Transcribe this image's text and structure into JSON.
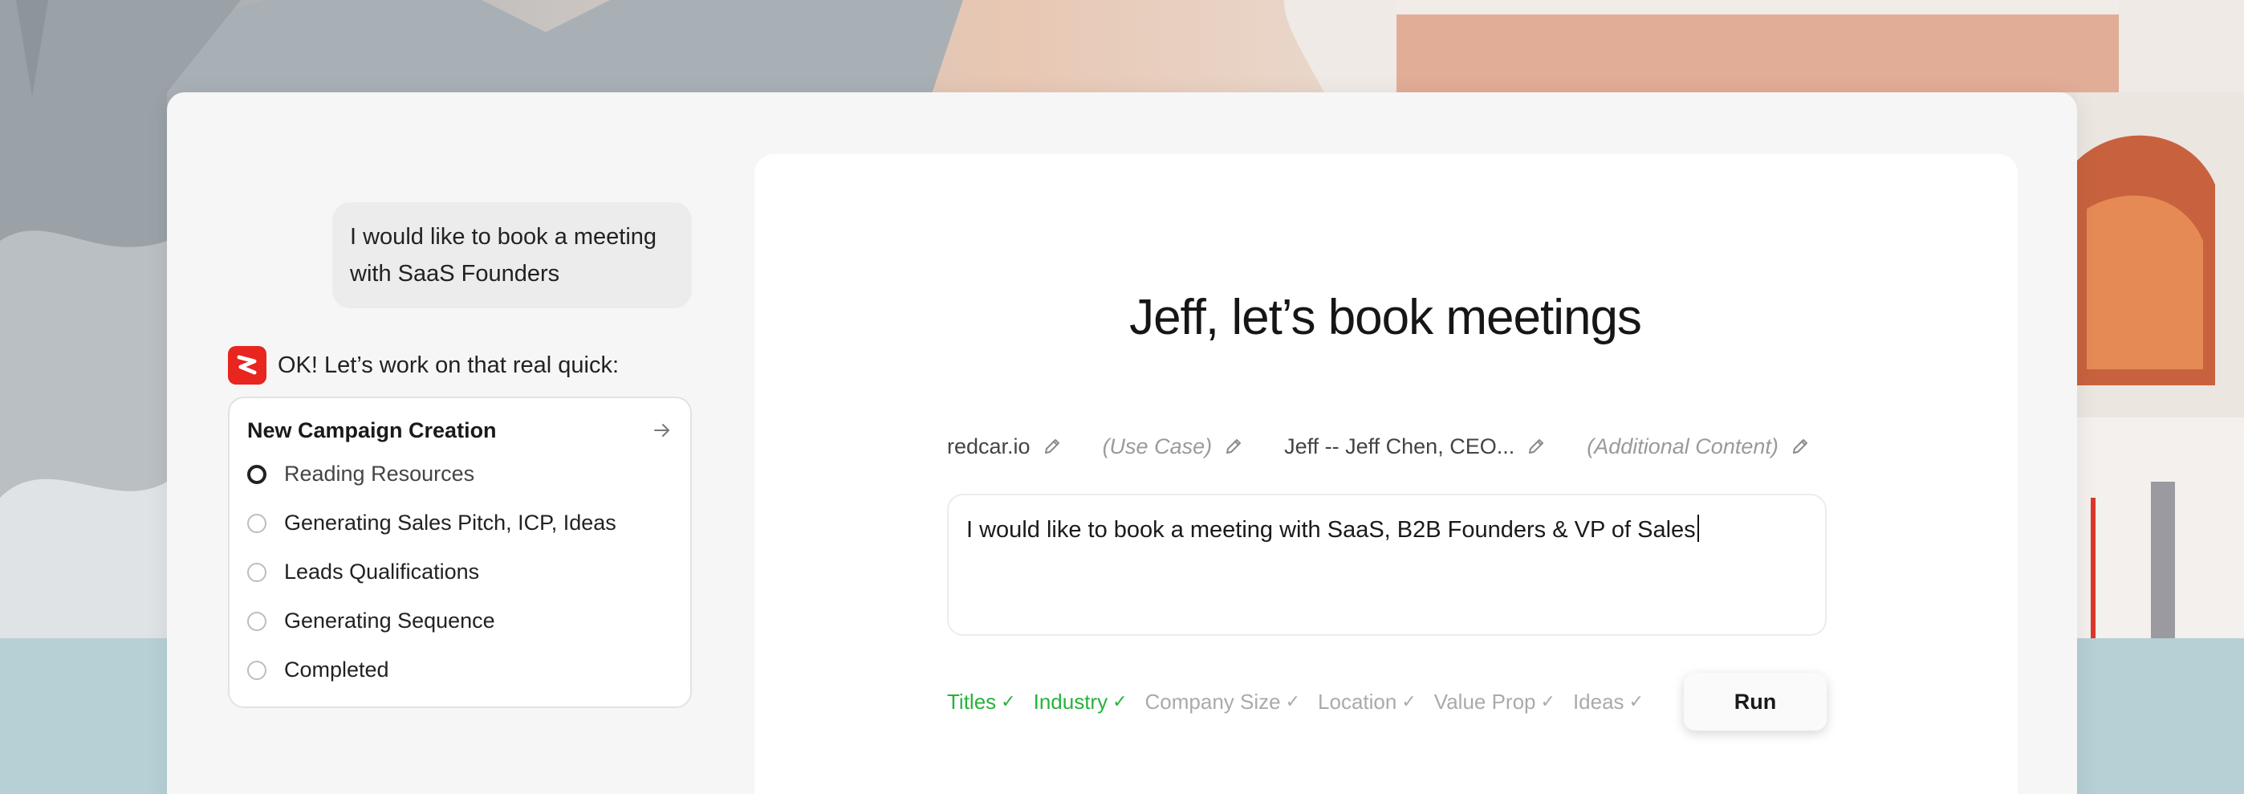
{
  "chat": {
    "user_message": "I would like to book a meeting with SaaS Founders",
    "bot_reply": "OK! Let’s work on that real quick:"
  },
  "task": {
    "title": "New Campaign Creation",
    "steps": [
      {
        "label": "Reading Resources",
        "state": "active"
      },
      {
        "label": "Generating Sales Pitch, ICP, Ideas",
        "state": "pending"
      },
      {
        "label": "Leads Qualifications",
        "state": "pending"
      },
      {
        "label": "Generating Sequence",
        "state": "pending"
      },
      {
        "label": "Completed",
        "state": "pending"
      }
    ]
  },
  "panel": {
    "headline": "Jeff, let’s book meetings",
    "params": [
      {
        "label": "redcar.io",
        "placeholder": false
      },
      {
        "label": "(Use Case)",
        "placeholder": true
      },
      {
        "label": "Jeff -- Jeff Chen, CEO...",
        "placeholder": false
      },
      {
        "label": "(Additional Content)",
        "placeholder": true
      }
    ],
    "prompt": "I would like to book a meeting with SaaS, B2B Founders & VP of Sales",
    "tags": [
      {
        "label": "Titles",
        "done": true
      },
      {
        "label": "Industry",
        "done": true
      },
      {
        "label": "Company Size",
        "done": false
      },
      {
        "label": "Location",
        "done": false
      },
      {
        "label": "Value Prop",
        "done": false
      },
      {
        "label": "Ideas",
        "done": false
      }
    ],
    "check_glyph": "✓",
    "run_label": "Run"
  },
  "colors": {
    "brand": "#e8251e",
    "done": "#26b33a",
    "muted": "#aaaaaa"
  },
  "icons": {
    "logo": "redcar-logo-icon",
    "arrow": "arrow-right-icon",
    "edit": "pencil-icon",
    "check": "check-icon"
  }
}
